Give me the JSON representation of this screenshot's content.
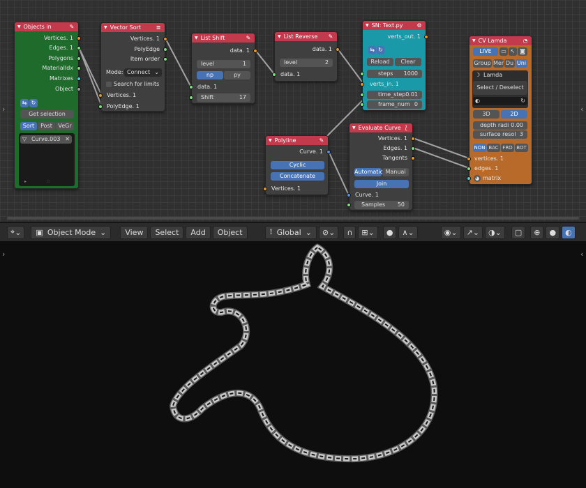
{
  "objects_in": {
    "title": "Objects in",
    "outputs": [
      "Vertices. 1",
      "Edges. 1",
      "Polygons",
      "MaterialIdx",
      "Matrixes",
      "Object"
    ],
    "get_selection": "Get selection",
    "tabs": [
      "Sort",
      "Post",
      "VeGr"
    ],
    "item": "Curve.003"
  },
  "vector_sort": {
    "title": "Vector Sort",
    "outputs": [
      "Vertices. 1",
      "PolyEdge",
      "Item order"
    ],
    "mode_label": "Mode:",
    "mode_value": "Connect",
    "search_limits": "Search for limits",
    "inputs": [
      "Vertices. 1",
      "PolyEdge. 1"
    ]
  },
  "list_shift": {
    "title": "List Shift",
    "output": "data. 1",
    "level_label": "level",
    "level_value": "1",
    "np": "np",
    "py": "py",
    "input": "data. 1",
    "shift_label": "Shift",
    "shift_value": "17"
  },
  "list_reverse": {
    "title": "List Reverse",
    "output": "data. 1",
    "level_label": "level",
    "level_value": "2",
    "input": "data. 1"
  },
  "sn_text": {
    "title": "SN: Text.py",
    "output": "verts_out. 1",
    "reload": "Reload",
    "clear": "Clear",
    "steps_label": "steps",
    "steps_value": "1000",
    "verts_in": "verts_in. 1",
    "time_step_label": "time_step",
    "time_step_value": "0.01",
    "frame_num_label": "frame_num",
    "frame_num_value": "0"
  },
  "polyline": {
    "title": "Polyline",
    "output": "Curve. 1",
    "cyclic": "Cyclic",
    "concatenate": "Concatenate",
    "input": "Vertices. 1"
  },
  "evaluate_curve": {
    "title": "Evaluate Curve",
    "outputs": [
      "Vertices. 1",
      "Edges. 1",
      "Tangents"
    ],
    "automatic": "Automatic",
    "manual": "Manual",
    "join": "Join",
    "input": "Curve. 1",
    "samples_label": "Samples",
    "samples_value": "50"
  },
  "cv_lamda": {
    "title": "CV Lamda",
    "live": "LIVE",
    "group": "Group",
    "mer": "Mer",
    "du": "Du",
    "uni": "Uni",
    "lamda": "Lamda",
    "select": "Select / Deselect",
    "three_d": "3D",
    "two_d": "2D",
    "depth_label": "depth radi",
    "depth_value": "0.00",
    "surface_label": "surface resol",
    "surface_value": "3",
    "caps": [
      "NON",
      "BAC",
      "FRO",
      "BOT"
    ],
    "inputs": [
      "vertices. 1",
      "edges. 1",
      "matrix"
    ]
  },
  "header": {
    "mode": "Object Mode",
    "menus": [
      "View",
      "Select",
      "Add",
      "Object"
    ],
    "orientation": "Global"
  },
  "colors": {
    "node_header": "#c23a4c",
    "accent": "#4772b3",
    "green_node": "#1e6b2c",
    "teal_node": "#1a9aa8",
    "orange_node": "#b86a2a"
  }
}
